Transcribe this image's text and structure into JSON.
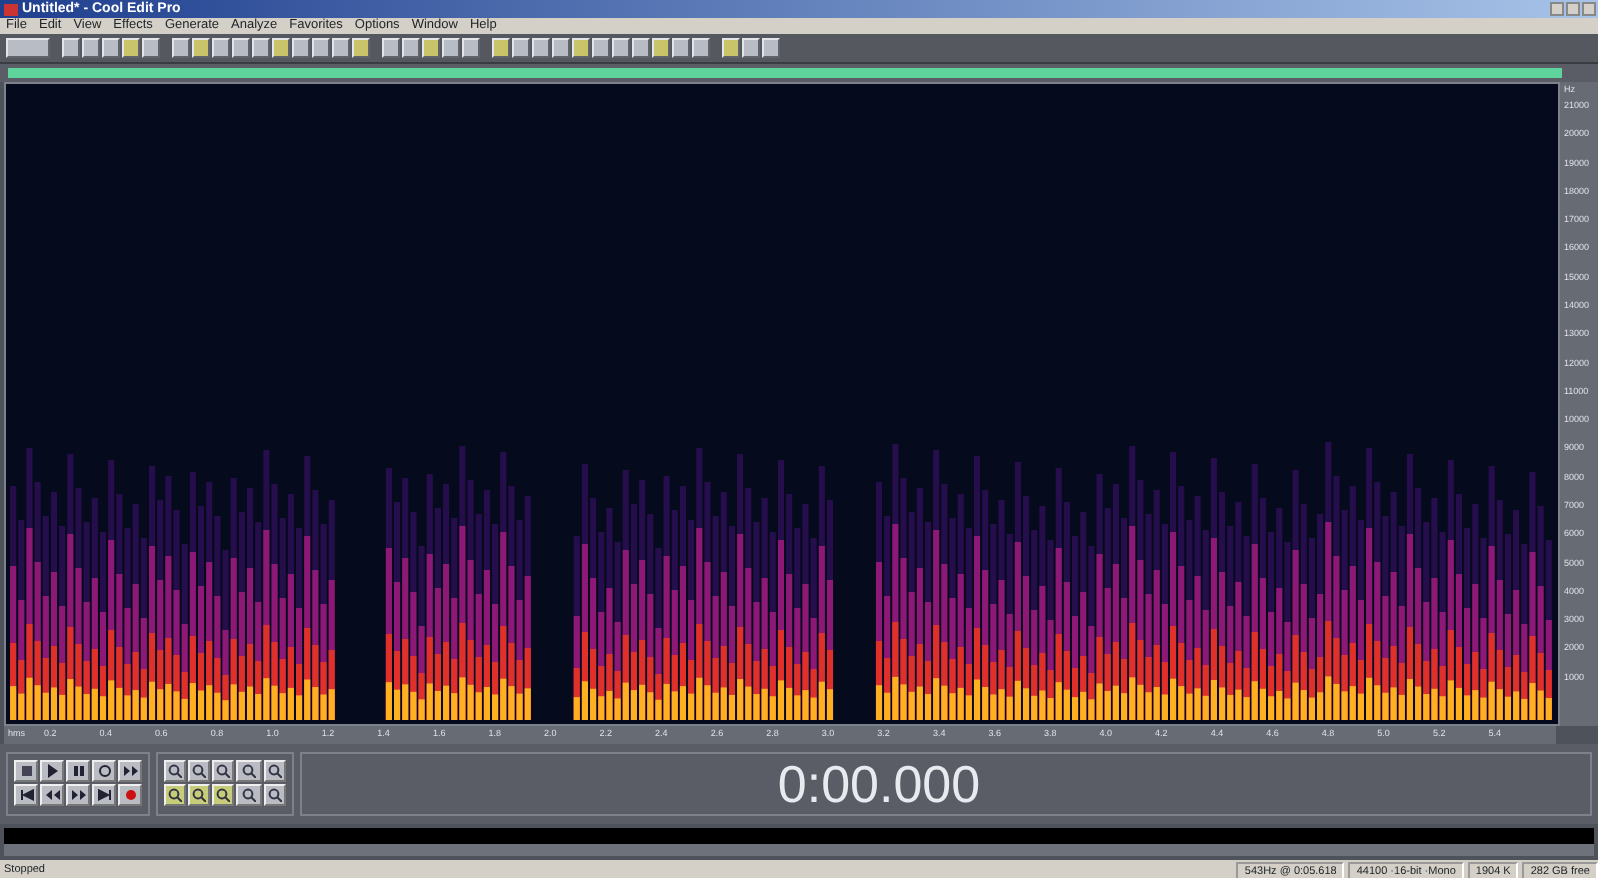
{
  "window": {
    "title": "Untitled* - Cool Edit Pro"
  },
  "menu": [
    "File",
    "Edit",
    "View",
    "Effects",
    "Generate",
    "Analyze",
    "Favorites",
    "Options",
    "Window",
    "Help"
  ],
  "frequency_axis": {
    "unit": "Hz",
    "labels": [
      "21000",
      "20000",
      "19000",
      "18000",
      "17000",
      "16000",
      "15000",
      "14000",
      "13000",
      "12000",
      "11000",
      "10000",
      "9000",
      "8000",
      "7000",
      "6000",
      "5000",
      "4000",
      "3000",
      "2000",
      "1000"
    ]
  },
  "time_ruler": {
    "unit": "hms",
    "labels": [
      "0.2",
      "0.4",
      "0.6",
      "0.8",
      "1.0",
      "1.2",
      "1.4",
      "1.6",
      "1.8",
      "2.0",
      "2.2",
      "2.4",
      "2.6",
      "2.8",
      "3.0",
      "3.2",
      "3.4",
      "3.6",
      "3.8",
      "4.0",
      "4.2",
      "4.4",
      "4.6",
      "4.8",
      "5.0",
      "5.2",
      "5.4"
    ]
  },
  "time_display": "0:00.000",
  "status_bar": {
    "state": "Stopped",
    "fields": [
      "543Hz @ 0:05.618",
      "44100 ·16-bit ·Mono",
      "1904 K",
      "282 GB free"
    ]
  }
}
